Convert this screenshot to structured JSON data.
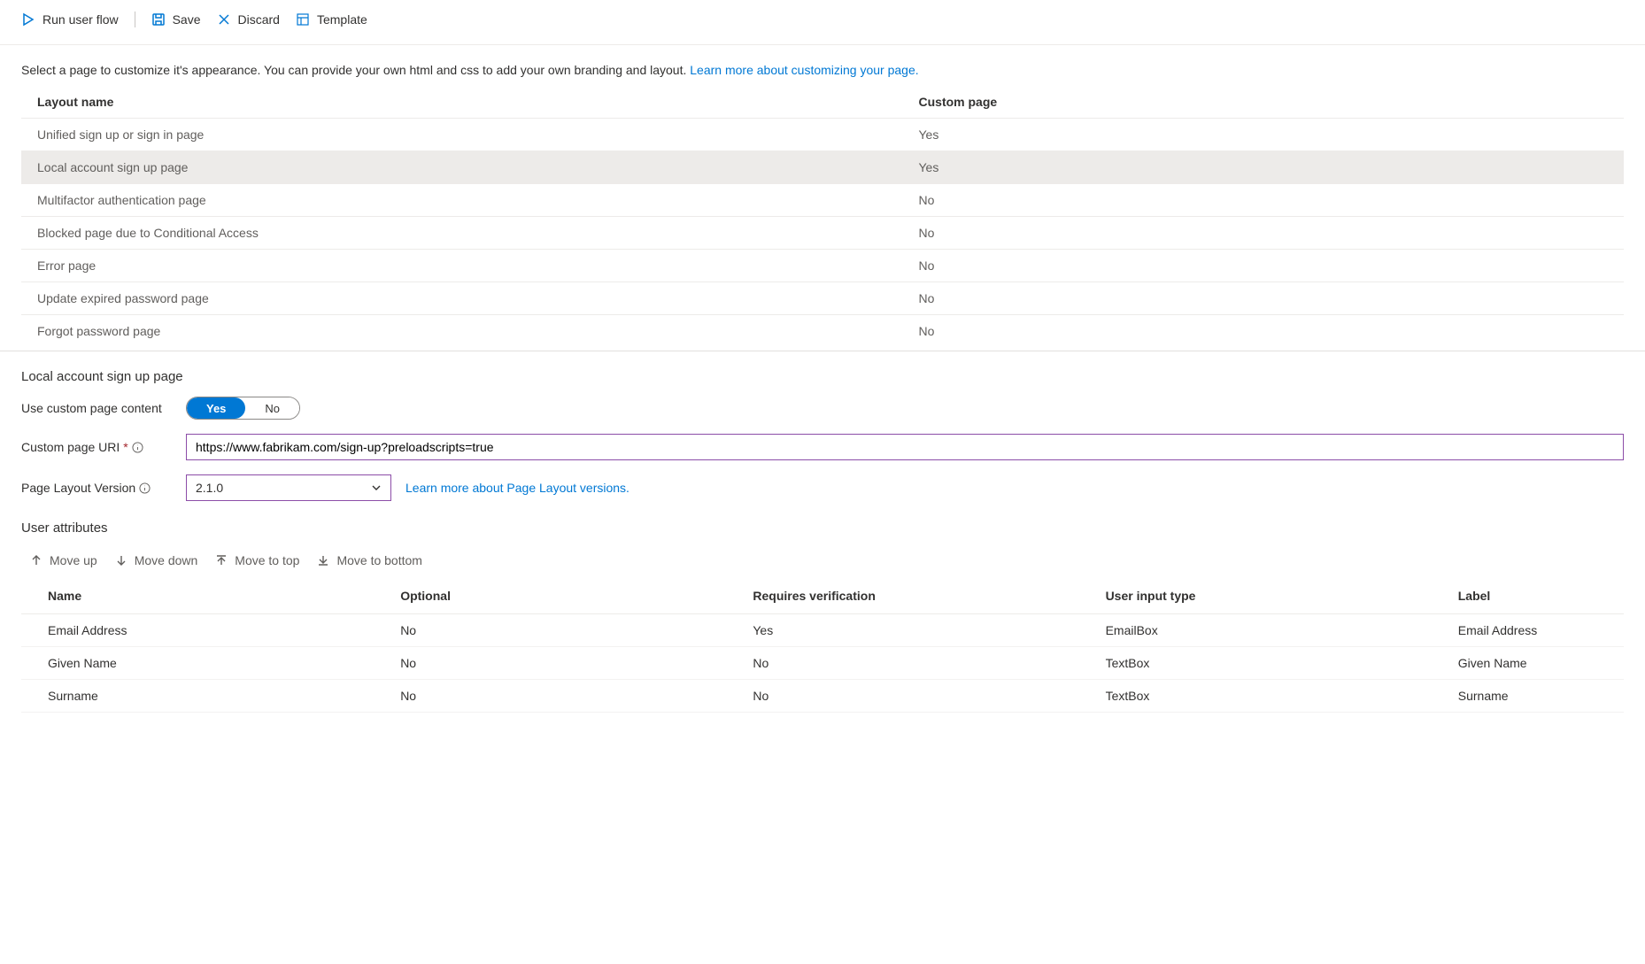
{
  "toolbar": {
    "run": "Run user flow",
    "save": "Save",
    "discard": "Discard",
    "template": "Template"
  },
  "intro": {
    "text": "Select a page to customize it's appearance. You can provide your own html and css to add your own branding and layout. ",
    "link": "Learn more about customizing your page."
  },
  "layoutTable": {
    "headers": {
      "name": "Layout name",
      "custom": "Custom page"
    },
    "rows": [
      {
        "name": "Unified sign up or sign in page",
        "custom": "Yes",
        "selected": false
      },
      {
        "name": "Local account sign up page",
        "custom": "Yes",
        "selected": true
      },
      {
        "name": "Multifactor authentication page",
        "custom": "No",
        "selected": false
      },
      {
        "name": "Blocked page due to Conditional Access",
        "custom": "No",
        "selected": false
      },
      {
        "name": "Error page",
        "custom": "No",
        "selected": false
      },
      {
        "name": "Update expired password page",
        "custom": "No",
        "selected": false
      },
      {
        "name": "Forgot password page",
        "custom": "No",
        "selected": false
      }
    ]
  },
  "detail": {
    "title": "Local account sign up page",
    "useCustomLabel": "Use custom page content",
    "toggle": {
      "yes": "Yes",
      "no": "No"
    },
    "uriLabel": "Custom page URI",
    "uriValue": "https://www.fabrikam.com/sign-up?preloadscripts=true",
    "versionLabel": "Page Layout Version",
    "versionValue": "2.1.0",
    "versionLink": "Learn more about Page Layout versions."
  },
  "attributes": {
    "title": "User attributes",
    "toolbar": {
      "up": "Move up",
      "down": "Move down",
      "top": "Move to top",
      "bottom": "Move to bottom"
    },
    "headers": {
      "name": "Name",
      "optional": "Optional",
      "verify": "Requires verification",
      "input": "User input type",
      "label": "Label"
    },
    "rows": [
      {
        "name": "Email Address",
        "optional": "No",
        "verify": "Yes",
        "input": "EmailBox",
        "label": "Email Address"
      },
      {
        "name": "Given Name",
        "optional": "No",
        "verify": "No",
        "input": "TextBox",
        "label": "Given Name"
      },
      {
        "name": "Surname",
        "optional": "No",
        "verify": "No",
        "input": "TextBox",
        "label": "Surname"
      }
    ]
  }
}
